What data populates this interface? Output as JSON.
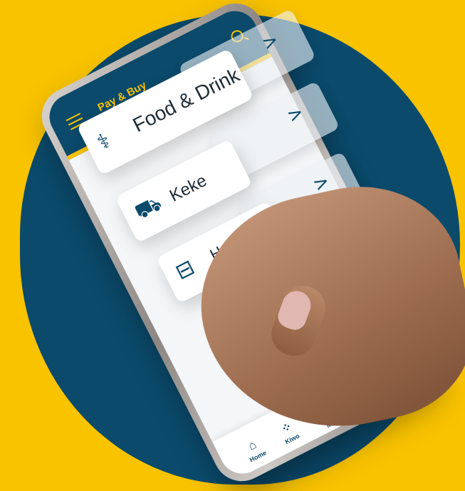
{
  "app": {
    "title": "Pay & Buy",
    "icons": {
      "menu": "hamburger-menu-icon",
      "search": "search-icon"
    }
  },
  "categories": [
    {
      "label": "Food & Drink",
      "icon": "food-drink-icon"
    },
    {
      "label": "Keke",
      "icon": "keke-vehicle-icon"
    },
    {
      "label": "Hotel",
      "icon": "hotel-bed-icon"
    }
  ],
  "chevron_symbol": ">",
  "bottom_nav": [
    {
      "label": "Home",
      "icon": "home-icon"
    },
    {
      "label": "Kiwo",
      "icon": "grid-dots-icon"
    },
    {
      "label": "Mo",
      "icon": "money-coin-icon"
    }
  ],
  "colors": {
    "brand_yellow": "#F9C300",
    "brand_navy": "#0B4A6B",
    "background": "#F9C300"
  }
}
